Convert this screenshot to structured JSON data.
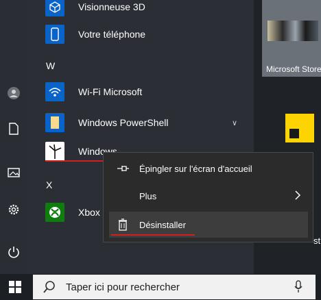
{
  "start_menu": {
    "apps": [
      {
        "label": "Visionneuse 3D",
        "icon": "cube-icon"
      },
      {
        "label": "Votre téléphone",
        "icon": "phone-icon"
      },
      {
        "label": "Wi-Fi Microsoft",
        "icon": "wifi-icon"
      },
      {
        "label": "Windows PowerShell",
        "icon": "folder-icon"
      },
      {
        "label": "Windows",
        "icon": "wind-turbine-icon"
      },
      {
        "label": "Xbox",
        "icon": "xbox-icon"
      }
    ],
    "letters": [
      "W",
      "X"
    ]
  },
  "tiles": {
    "store_label": "Microsoft Store",
    "partial_text": "st"
  },
  "context_menu": {
    "items": [
      {
        "label": "Épingler sur l'écran d'accueil",
        "icon": "pin-icon"
      },
      {
        "label": "Plus",
        "icon": "chevron-right-icon"
      },
      {
        "label": "Désinstaller",
        "icon": "trash-icon"
      }
    ]
  },
  "taskbar": {
    "search_placeholder": "Taper ici pour rechercher"
  },
  "colors": {
    "accent_blue": "#0a64c8",
    "sticky_yellow": "#fbd402",
    "xbox_green": "#107c10",
    "underline_red": "#d21f1f"
  }
}
